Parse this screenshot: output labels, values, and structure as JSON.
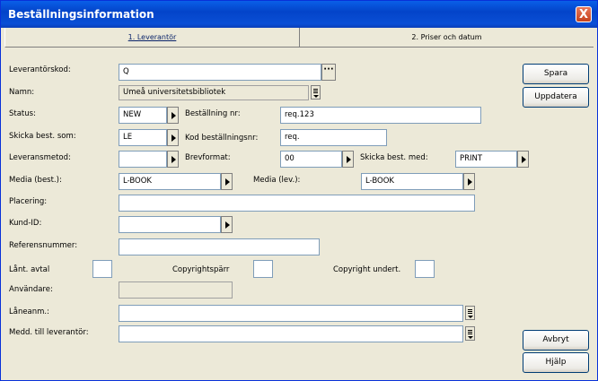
{
  "window": {
    "title": "Beställningsinformation",
    "close_label": "X"
  },
  "tabs": [
    {
      "label": "1. Leverantör"
    },
    {
      "label": "2. Priser och datum"
    }
  ],
  "form": {
    "leverantorskod": {
      "label": "Leverantörskod:",
      "value": "Q",
      "button": "···"
    },
    "namn": {
      "label": "Namn:",
      "value": "Umeå universitetsbibliotek"
    },
    "status": {
      "label": "Status:",
      "value": "NEW"
    },
    "bestallning_nr": {
      "label": "Beställning nr:",
      "value": "req.123"
    },
    "skicka_best_som": {
      "label": "Skicka best. som:",
      "value": "LE"
    },
    "kod_bestallningsnr": {
      "label": "Kod beställningsnr:",
      "value": "req."
    },
    "leveransmetod": {
      "label": "Leveransmetod:",
      "value": ""
    },
    "brevformat": {
      "label": "Brevformat:",
      "value": "00"
    },
    "skicka_best_med": {
      "label": "Skicka best. med:",
      "value": "PRINT"
    },
    "media_best": {
      "label": "Media (best.):",
      "value": "L-BOOK"
    },
    "media_lev": {
      "label": "Media (lev.):",
      "value": "L-BOOK"
    },
    "placering": {
      "label": "Placering:",
      "value": ""
    },
    "kund_id": {
      "label": "Kund-ID:",
      "value": ""
    },
    "referensnummer": {
      "label": "Referensnummer:",
      "value": ""
    },
    "lant_avtal": {
      "label": "Lånt. avtal"
    },
    "copyrightsparr": {
      "label": "Copyrightspärr"
    },
    "copyright_undert": {
      "label": "Copyright undert."
    },
    "anvandare": {
      "label": "Användare:",
      "value": ""
    },
    "laneanm": {
      "label": "Låneanm.:",
      "value": ""
    },
    "medd_till_leverantor": {
      "label": "Medd. till leverantör:",
      "value": ""
    }
  },
  "buttons": {
    "spara": "Spara",
    "uppdatera": "Uppdatera",
    "avbryt": "Avbryt",
    "hjalp": "Hjälp"
  }
}
